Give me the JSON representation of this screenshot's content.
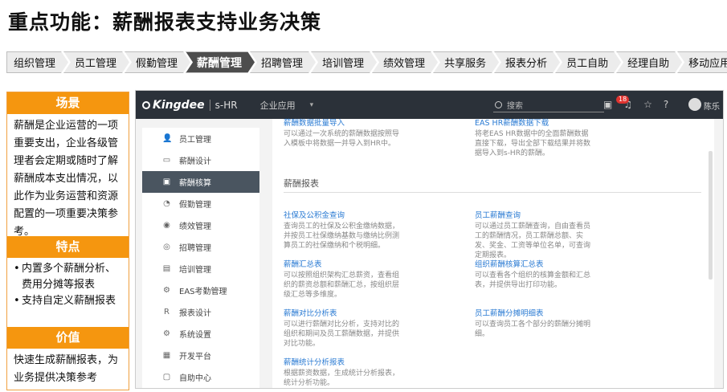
{
  "title": "重点功能：薪酬报表支持业务决策",
  "modules": [
    "组织管理",
    "员工管理",
    "假勤管理",
    "薪酬管理",
    "招聘管理",
    "培训管理",
    "绩效管理",
    "共享服务",
    "报表分析",
    "员工自助",
    "经理自助",
    "移动应用"
  ],
  "active_module": "薪酬管理",
  "panel": {
    "scene_title": "场景",
    "scene_text": "薪酬是企业运营的一项重要支出，企业各级管理者会定期或随时了解薪酬成本支出情况，以此作为业务运营和资源配置的一项重要决策参考。",
    "features_title": "特点",
    "features": [
      "内置多个薪酬分析、费用分摊等报表",
      "支持自定义薪酬报表"
    ],
    "value_title": "价值",
    "value_text": "快速生成薪酬报表，为业务提供决策参考"
  },
  "app": {
    "logo": "Kingdee",
    "product": "s-HR",
    "apps_menu": "企业应用",
    "apps_caret": "▾",
    "search_placeholder": "搜索",
    "notification_count": "18",
    "user": "陈乐",
    "sidebar": [
      {
        "icon": "person-icon",
        "glyph": "👤",
        "label": "员工管理"
      },
      {
        "icon": "design-icon",
        "glyph": "▭",
        "label": "薪酬设计"
      },
      {
        "icon": "salary-icon",
        "glyph": "▣",
        "label": "薪酬核算"
      },
      {
        "icon": "attendance-icon",
        "glyph": "◔",
        "label": "假勤管理"
      },
      {
        "icon": "performance-icon",
        "glyph": "◉",
        "label": "绩效管理"
      },
      {
        "icon": "recruit-icon",
        "glyph": "◎",
        "label": "招聘管理"
      },
      {
        "icon": "training-icon",
        "glyph": "▤",
        "label": "培训管理"
      },
      {
        "icon": "eas-icon",
        "glyph": "⚙",
        "label": "EAS考勤管理"
      },
      {
        "icon": "report-icon",
        "glyph": "R",
        "label": "报表设计"
      },
      {
        "icon": "settings-icon",
        "glyph": "⚙",
        "label": "系统设置"
      },
      {
        "icon": "platform-icon",
        "glyph": "▦",
        "label": "开发平台"
      },
      {
        "icon": "self-icon",
        "glyph": "▢",
        "label": "自助中心"
      }
    ],
    "active_sidebar": "薪酬核算",
    "top_tiles": [
      {
        "title": "薪酬数据批量导入",
        "desc": "可以通过一次系统的薪酬数据按照导入模板中将数据一并导入到HR中。"
      },
      {
        "title": "EAS HR薪酬数据下载",
        "desc": "将老EAS HR数据中的全面薪酬数据直接下载，导出全部下载结果并将数据导入到s-HR的薪酬。"
      }
    ],
    "section_title": "薪酬报表",
    "tiles": [
      {
        "title": "社保及公积金查询",
        "desc": "查询员工的社保及公积金缴纳数据，并按员工社保缴纳基数与缴纳比例测算员工的社保缴纳和个税明细。"
      },
      {
        "title": "员工薪酬查询",
        "desc": "可以通过员工薪酬查询，自由查看员工的薪酬情况，员工薪酬总额、实发、奖金、工资等单位名单，可查询定期报表。"
      },
      {
        "title": "薪酬汇总表",
        "desc": "可以按照组织架构汇总薪资，查看组织的薪资总额和薪酬汇总，按组织层级汇总等多维度。"
      },
      {
        "title": "组织薪酬核算汇总表",
        "desc": "可以查看各个组织的核算金额和汇总表，并提供导出打印功能。"
      },
      {
        "title": "薪酬对比分析表",
        "desc": "可以进行薪酬对比分析，支持对比的组织和期间及员工薪酬数据，并提供对比功能。"
      },
      {
        "title": "员工薪酬分摊明细表",
        "desc": "可以查询员工各个部分的薪酬分摊明细。"
      },
      {
        "title": "薪酬统计分析报表",
        "desc": "根据薪资数据，生成统计分析报表，统计分析功能。"
      }
    ]
  }
}
